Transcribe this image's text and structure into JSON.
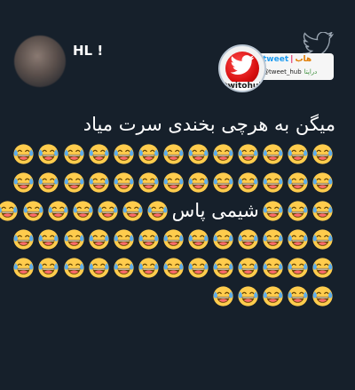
{
  "tweet": {
    "username": "HL !",
    "text_line1": "میگن به هرچی بخندی سرت میاد",
    "inline_text": "شیمی پاس",
    "emoji_name": "face-with-tears-of-joy-icon",
    "rows": [
      {
        "before": 13,
        "text": false,
        "after": 0
      },
      {
        "before": 13,
        "text": false,
        "after": 0
      },
      {
        "before": 3,
        "text": true,
        "after": 7
      },
      {
        "before": 13,
        "text": false,
        "after": 0
      },
      {
        "before": 13,
        "text": false,
        "after": 0
      },
      {
        "before": 5,
        "text": false,
        "after": 0
      }
    ]
  },
  "watermark": {
    "brand_en": "tweet",
    "brand_fa": "هاب",
    "handle": "@tweet_hub",
    "tag_fa": "دراپتا",
    "circle_text": "twitohub"
  },
  "colors": {
    "background": "#16202b",
    "text": "#ffffff",
    "accent_blue": "#1d9bf0",
    "logo_red": "#d80f0f"
  }
}
